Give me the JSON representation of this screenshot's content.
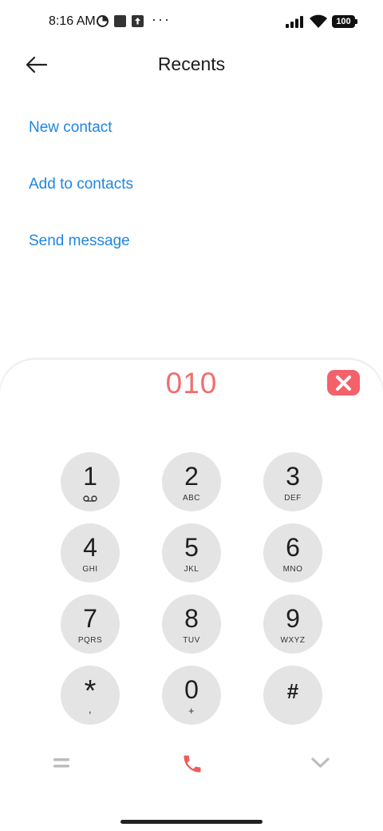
{
  "status_bar": {
    "time": "8:16 AM",
    "battery": "100",
    "icons": [
      "data-saver-icon",
      "square-icon",
      "upload-icon",
      "more-dots-icon",
      "signal-icon",
      "wifi-icon",
      "battery-icon"
    ],
    "more": "···"
  },
  "header": {
    "title": "Recents",
    "back_icon": "back-arrow-icon"
  },
  "actions": [
    "New contact",
    "Add to contacts",
    "Send message"
  ],
  "dialer": {
    "number": "010",
    "keys": [
      {
        "digit": "1",
        "letters": ""
      },
      {
        "digit": "2",
        "letters": "ABC"
      },
      {
        "digit": "3",
        "letters": "DEF"
      },
      {
        "digit": "4",
        "letters": "GHI"
      },
      {
        "digit": "5",
        "letters": "JKL"
      },
      {
        "digit": "6",
        "letters": "MNO"
      },
      {
        "digit": "7",
        "letters": "PQRS"
      },
      {
        "digit": "8",
        "letters": "TUV"
      },
      {
        "digit": "9",
        "letters": "WXYZ"
      },
      {
        "digit": "*",
        "letters": ","
      },
      {
        "digit": "0",
        "letters": "+"
      },
      {
        "digit": "#",
        "letters": ""
      }
    ]
  },
  "colors": {
    "link": "#1e86e0",
    "number": "#ef6f6e",
    "clear_button": "#f3626b",
    "key_bg": "#e4e4e4",
    "call": "#ef5b5b"
  }
}
